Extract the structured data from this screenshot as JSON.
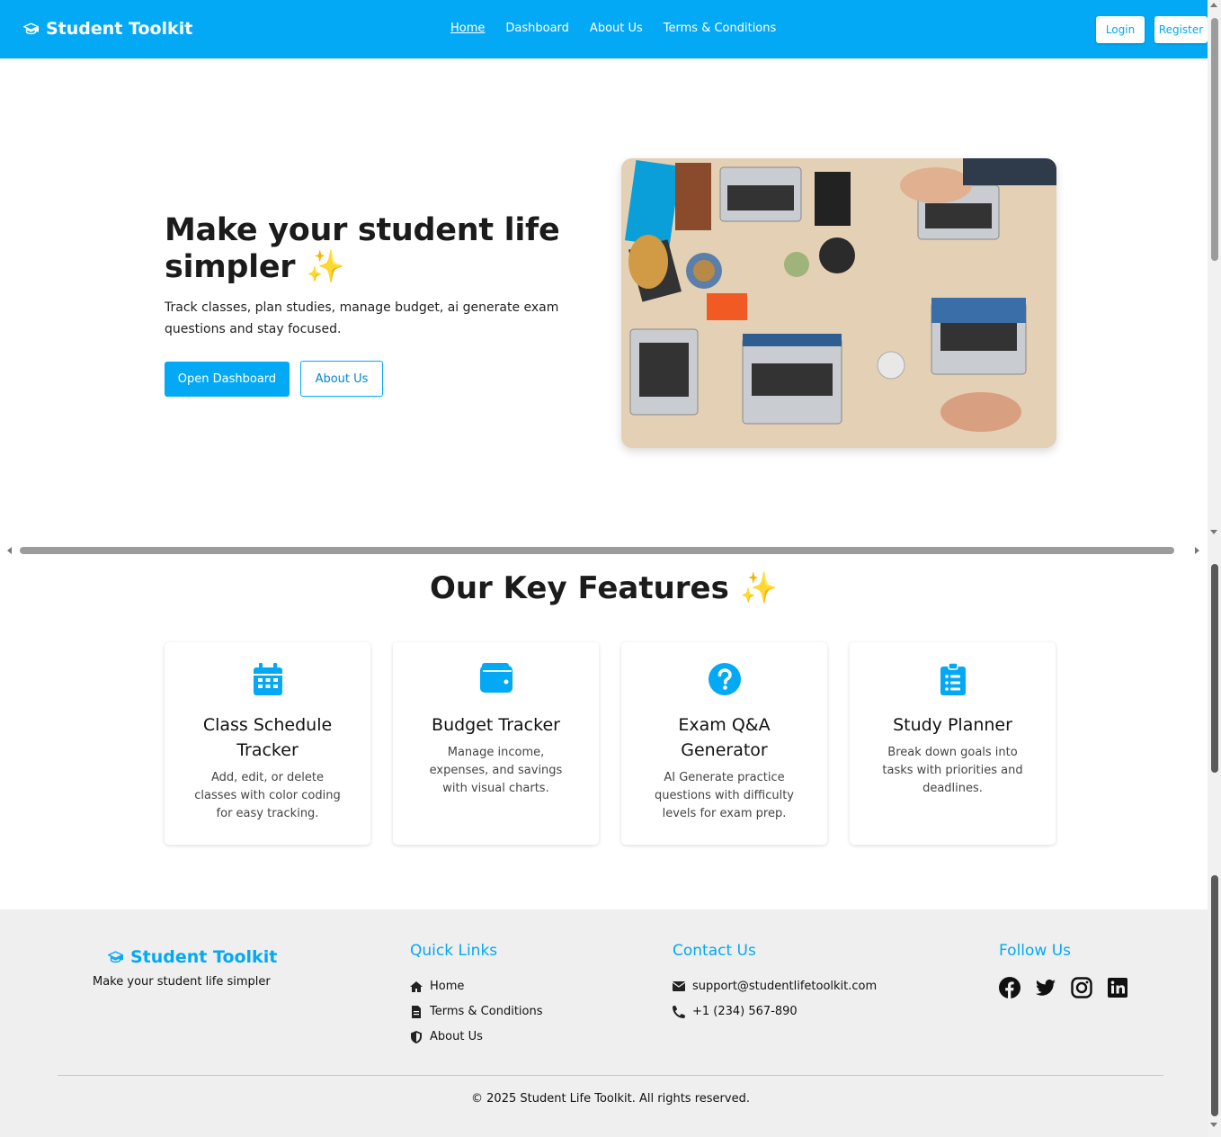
{
  "navbar": {
    "brand": "Student Toolkit",
    "links": [
      "Home",
      "Dashboard",
      "About Us",
      "Terms & Conditions"
    ],
    "login": "Login",
    "register": "Register"
  },
  "hero": {
    "title": "Make your student life simpler ✨",
    "subtitle": "Track classes, plan studies, manage budget, ai generate exam questions and stay focused.",
    "primary_button": "Open Dashboard",
    "secondary_button": "About Us",
    "image": "students-working-desk-photo"
  },
  "features": {
    "title": "Our Key Features ✨",
    "cards": [
      {
        "icon": "calendar-icon",
        "title": "Class Schedule Tracker",
        "desc": "Add, edit, or delete classes with color coding for easy tracking."
      },
      {
        "icon": "wallet-icon",
        "title": "Budget Tracker",
        "desc": "Manage income, expenses, and savings with visual charts."
      },
      {
        "icon": "question-circle-icon",
        "title": "Exam Q&A Generator",
        "desc": "AI Generate practice questions with difficulty levels for exam prep."
      },
      {
        "icon": "clipboard-list-icon",
        "title": "Study Planner",
        "desc": "Break down goals into tasks with priorities and deadlines."
      }
    ]
  },
  "footer": {
    "brand": "Student Toolkit",
    "tagline": "Make your student life simpler",
    "quick_links_title": "Quick Links",
    "quick_links": [
      "Home",
      "Terms & Conditions",
      "About Us"
    ],
    "contact_title": "Contact Us",
    "email": "support@studentlifetoolkit.com",
    "phone": "+1 (234) 567-890",
    "follow_title": "Follow Us",
    "social": [
      "facebook-icon",
      "twitter-icon",
      "instagram-icon",
      "linkedin-icon"
    ],
    "copyright": "© 2025 Student Life Toolkit. All rights reserved."
  },
  "colors": {
    "accent": "#03a9f4",
    "footer_bg": "#efefef"
  }
}
